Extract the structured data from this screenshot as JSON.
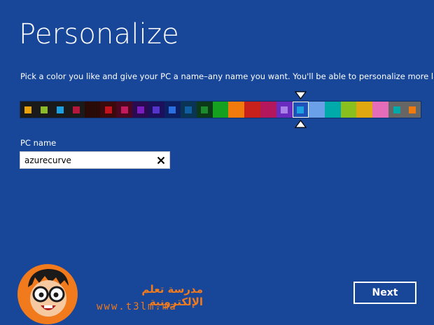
{
  "page": {
    "title": "Personalize",
    "subtitle": "Pick a color you like and give your PC a name–any name you want. You'll be able to personalize more later.",
    "background": "#18479a"
  },
  "palette": {
    "selected_index": 17,
    "swatches": [
      {
        "bg": "#1a1a1a",
        "dot": "#e8a20c"
      },
      {
        "bg": "#1a1a1a",
        "dot": "#8bbb2c"
      },
      {
        "bg": "#1a1a1a",
        "dot": "#1ba1e2"
      },
      {
        "bg": "#1a1a1a",
        "dot": "#b4173b"
      },
      {
        "bg": "#2a0a06",
        "dot": "#2a0a06"
      },
      {
        "bg": "#3b0a0c",
        "dot": "#c4121f"
      },
      {
        "bg": "#4a0820",
        "dot": "#c21a5c"
      },
      {
        "bg": "#2a0a50",
        "dot": "#7a1dbf"
      },
      {
        "bg": "#1c0f5c",
        "dot": "#5534c9"
      },
      {
        "bg": "#0c1f63",
        "dot": "#2a6ee0"
      },
      {
        "bg": "#0a3454",
        "dot": "#0e5ea0"
      },
      {
        "bg": "#0c3a18",
        "dot": "#1e8a2e"
      },
      {
        "bg": "#16a020",
        "dot": "#16a020"
      },
      {
        "bg": "#f07a0c",
        "dot": "#f07a0c"
      },
      {
        "bg": "#c8211c",
        "dot": "#c8211c"
      },
      {
        "bg": "#b4175c",
        "dot": "#b4175c"
      },
      {
        "bg": "#6a2bbf",
        "dot": "#a880e8"
      },
      {
        "bg": "#1e52b8",
        "dot": "#1ba1e2"
      },
      {
        "bg": "#6aa0e8",
        "dot": "#6aa0e8"
      },
      {
        "bg": "#00aaaa",
        "dot": "#00aaaa"
      },
      {
        "bg": "#8ac01e",
        "dot": "#8ac01e"
      },
      {
        "bg": "#e0a80e",
        "dot": "#e0a80e"
      },
      {
        "bg": "#e46cb8",
        "dot": "#e46cb8"
      },
      {
        "bg": "#666666",
        "dot": "#00aaaa"
      },
      {
        "bg": "#666666",
        "dot": "#f07a0c"
      }
    ]
  },
  "pc_name": {
    "label": "PC name",
    "value": "azurecurve",
    "clear_icon": "close-icon"
  },
  "actions": {
    "next_label": "Next"
  },
  "watermark": {
    "arabic_text": "مدرسة تعلم الإلكترونية",
    "url": "www.t3lm.ma",
    "color": "#f07a1c"
  }
}
